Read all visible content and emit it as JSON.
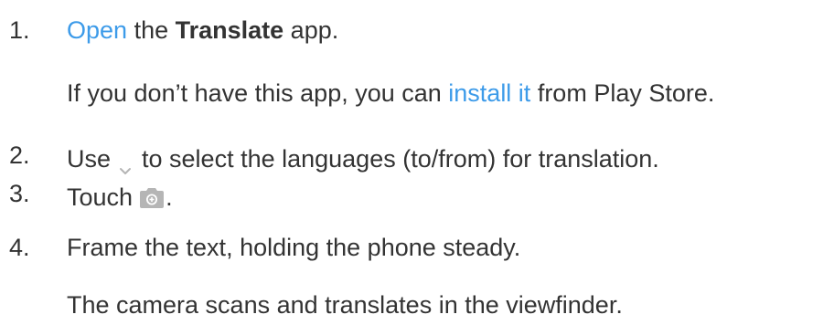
{
  "steps": [
    {
      "number": "1.",
      "link": "Open",
      "text_mid": " the ",
      "bold": "Translate",
      "text_end": " app.",
      "note_pre": "If you don’t have this app, you can ",
      "note_link": "install it",
      "note_post": " from Play Store."
    },
    {
      "number": "2.",
      "text_pre": "Use",
      "icon": "chevron-down-icon",
      "text_post": "to select the languages (to/from) for translation."
    },
    {
      "number": "3.",
      "text_pre": "Touch",
      "icon": "camera-icon",
      "text_post": "."
    },
    {
      "number": "4.",
      "text": "Frame the text, holding the phone steady.",
      "note": "The camera scans and translates in the viewfinder."
    }
  ],
  "colors": {
    "text": "#333333",
    "link": "#3d9be9",
    "icon": "#b5b5b5"
  }
}
